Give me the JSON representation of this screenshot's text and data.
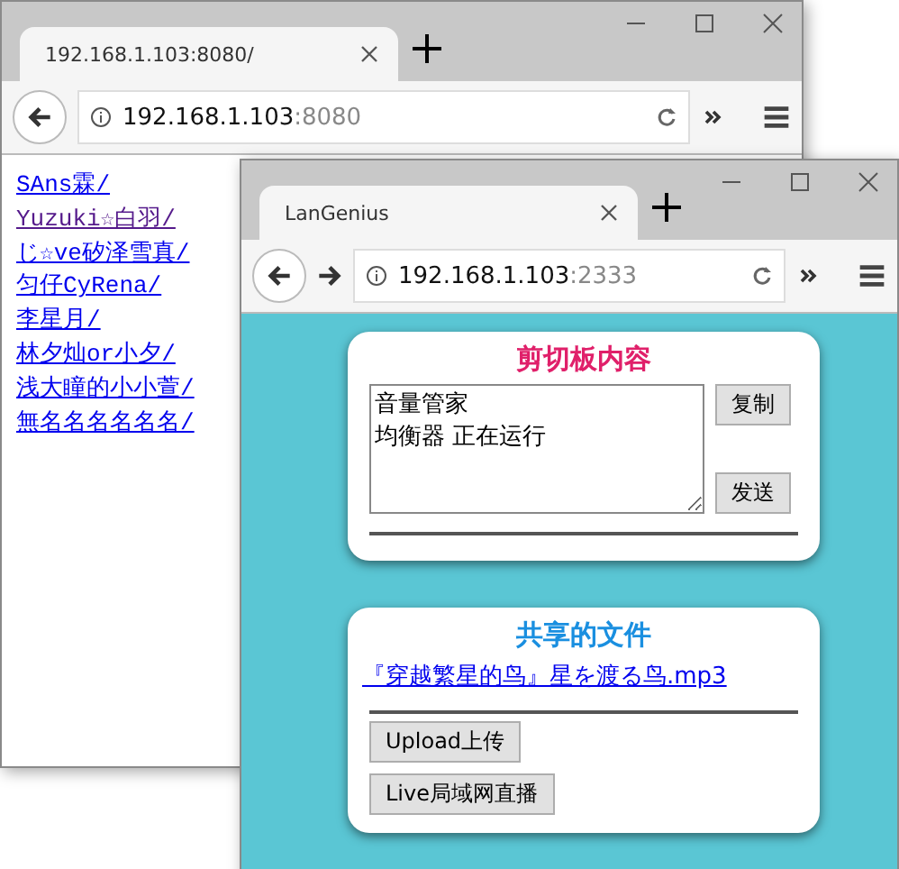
{
  "windows": [
    {
      "tab_title": "192.168.1.103:8080/",
      "address_host": "192.168.1.103",
      "address_port": ":8080",
      "forward_button": false,
      "kind": "listing",
      "links": [
        {
          "text": "SAns霖/",
          "visited": false
        },
        {
          "text": "Yuzuki☆白羽/",
          "visited": true
        },
        {
          "text": "じ☆ve矽泽雪真/",
          "visited": false
        },
        {
          "text": "匀仔CyRena/",
          "visited": false
        },
        {
          "text": "李星月/",
          "visited": false
        },
        {
          "text": "林夕灿or小夕/",
          "visited": false
        },
        {
          "text": "浅大瞳的小小萱/",
          "visited": false
        },
        {
          "text": "無名名名名名名/",
          "visited": false
        }
      ]
    },
    {
      "tab_title": "LanGenius",
      "address_host": "192.168.1.103",
      "address_port": ":2333",
      "forward_button": true,
      "kind": "app",
      "clipboard": {
        "title": "剪切板内容",
        "lines": [
          "音量管家",
          "均衡器 正在运行"
        ],
        "buttons": [
          "复制",
          "发送"
        ]
      },
      "shared": {
        "title": "共享的文件",
        "files": [
          "『穿越繁星的鸟』星を渡る鸟.mp3"
        ],
        "buttons": [
          "Upload上传",
          "Live局域网直播"
        ]
      }
    }
  ]
}
